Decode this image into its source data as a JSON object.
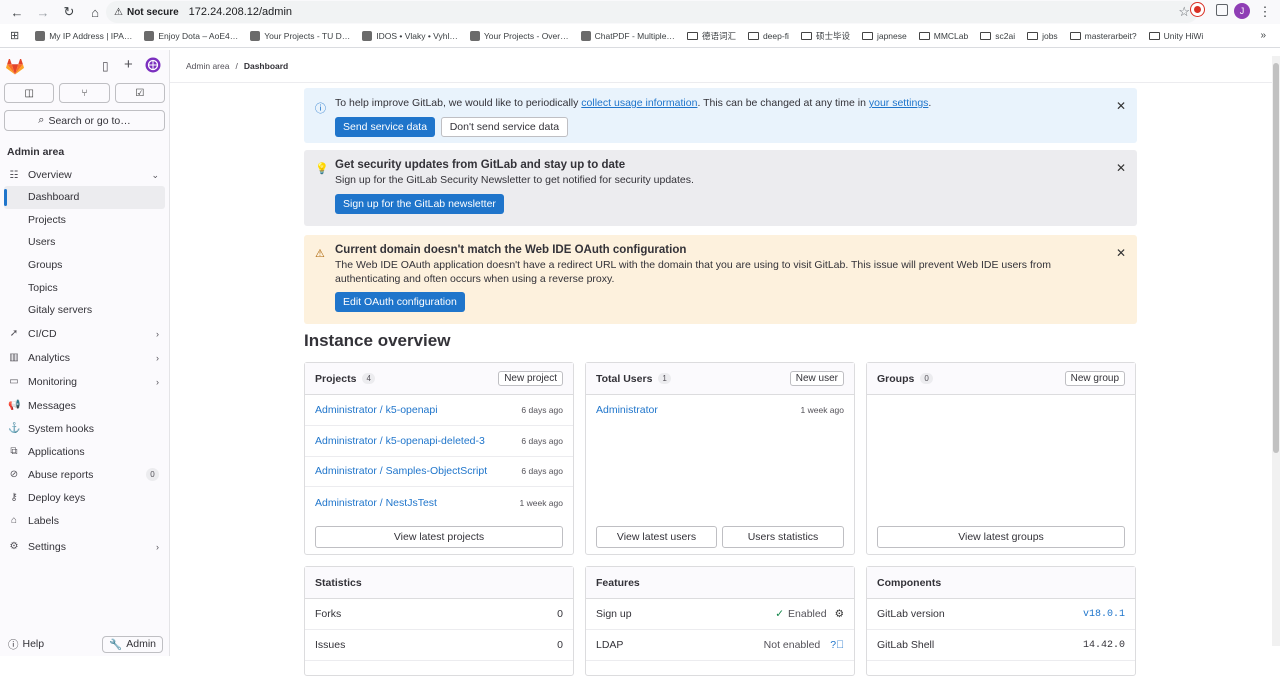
{
  "browser": {
    "not_secure": "Not secure",
    "url": "172.24.208.12/admin",
    "avatar_letter": "J",
    "bookmarks": [
      "My IP Address | IPA…",
      "Enjoy Dota – AoE4…",
      "Your Projects - TU D…",
      "IDOS • Vlaky • Vyhl…",
      "Your Projects - Over…",
      "ChatPDF - Multiple…",
      "德语词汇",
      "deep-fi",
      "硕士毕设",
      "japnese",
      "MMCLab",
      "sc2ai",
      "jobs",
      "masterarbeit?",
      "Unity HiWi"
    ],
    "bookmark_types": [
      "site",
      "site",
      "site",
      "site",
      "site",
      "site",
      "folder",
      "folder",
      "folder",
      "folder",
      "folder",
      "folder",
      "folder",
      "folder",
      "folder"
    ],
    "more": "»"
  },
  "sidebar": {
    "search": "Search or go to…",
    "heading": "Admin area",
    "overview": "Overview",
    "overview_items": [
      "Dashboard",
      "Projects",
      "Users",
      "Groups",
      "Topics",
      "Gitaly servers"
    ],
    "ci_cd": "CI/CD",
    "analytics": "Analytics",
    "monitoring": "Monitoring",
    "messages": "Messages",
    "system_hooks": "System hooks",
    "applications": "Applications",
    "abuse_reports": "Abuse reports",
    "abuse_count": "0",
    "deploy_keys": "Deploy keys",
    "labels": "Labels",
    "settings": "Settings",
    "help": "Help",
    "admin": "Admin"
  },
  "breadcrumb": {
    "parent": "Admin area",
    "sep": "/",
    "current": "Dashboard"
  },
  "alerts": {
    "usage": {
      "text1": "To help improve GitLab, we would like to periodically ",
      "link1": "collect usage information",
      "text2": ". This can be changed at any time in ",
      "link2": "your settings",
      "text3": ".",
      "btn_send": "Send service data",
      "btn_dont": "Don't send service data"
    },
    "security": {
      "title": "Get security updates from GitLab and stay up to date",
      "text": "Sign up for the GitLab Security Newsletter to get notified for security updates.",
      "btn": "Sign up for the GitLab newsletter"
    },
    "oauth": {
      "title": "Current domain doesn't match the Web IDE OAuth configuration",
      "text": "The Web IDE OAuth application doesn't have a redirect URL with the domain that you are using to visit GitLab. This issue will prevent Web IDE users from authenticating and often occurs when using a reverse proxy.",
      "btn": "Edit OAuth configuration"
    }
  },
  "page_title": "Instance overview",
  "projects": {
    "title": "Projects",
    "count": "4",
    "new": "New project",
    "rows": [
      {
        "name": "Administrator / k5-openapi",
        "time": "6 days ago"
      },
      {
        "name": "Administrator / k5-openapi-deleted-3",
        "time": "6 days ago"
      },
      {
        "name": "Administrator / Samples-ObjectScript",
        "time": "6 days ago"
      },
      {
        "name": "Administrator / NestJsTest",
        "time": "1 week ago"
      }
    ],
    "view": "View latest projects"
  },
  "users": {
    "title": "Total Users",
    "count": "1",
    "new": "New user",
    "rows": [
      {
        "name": "Administrator",
        "time": "1 week ago"
      }
    ],
    "view": "View latest users",
    "stats": "Users statistics"
  },
  "groups": {
    "title": "Groups",
    "count": "0",
    "new": "New group",
    "view": "View latest groups"
  },
  "statistics": {
    "title": "Statistics",
    "rows": [
      {
        "label": "Forks",
        "value": "0"
      },
      {
        "label": "Issues",
        "value": "0"
      }
    ]
  },
  "features": {
    "title": "Features",
    "rows": [
      {
        "label": "Sign up",
        "value": "Enabled"
      },
      {
        "label": "LDAP",
        "value": "Not enabled"
      }
    ]
  },
  "components": {
    "title": "Components",
    "rows": [
      {
        "label": "GitLab version",
        "value": "v18.0.1"
      },
      {
        "label": "GitLab Shell",
        "value": "14.42.0"
      }
    ]
  }
}
